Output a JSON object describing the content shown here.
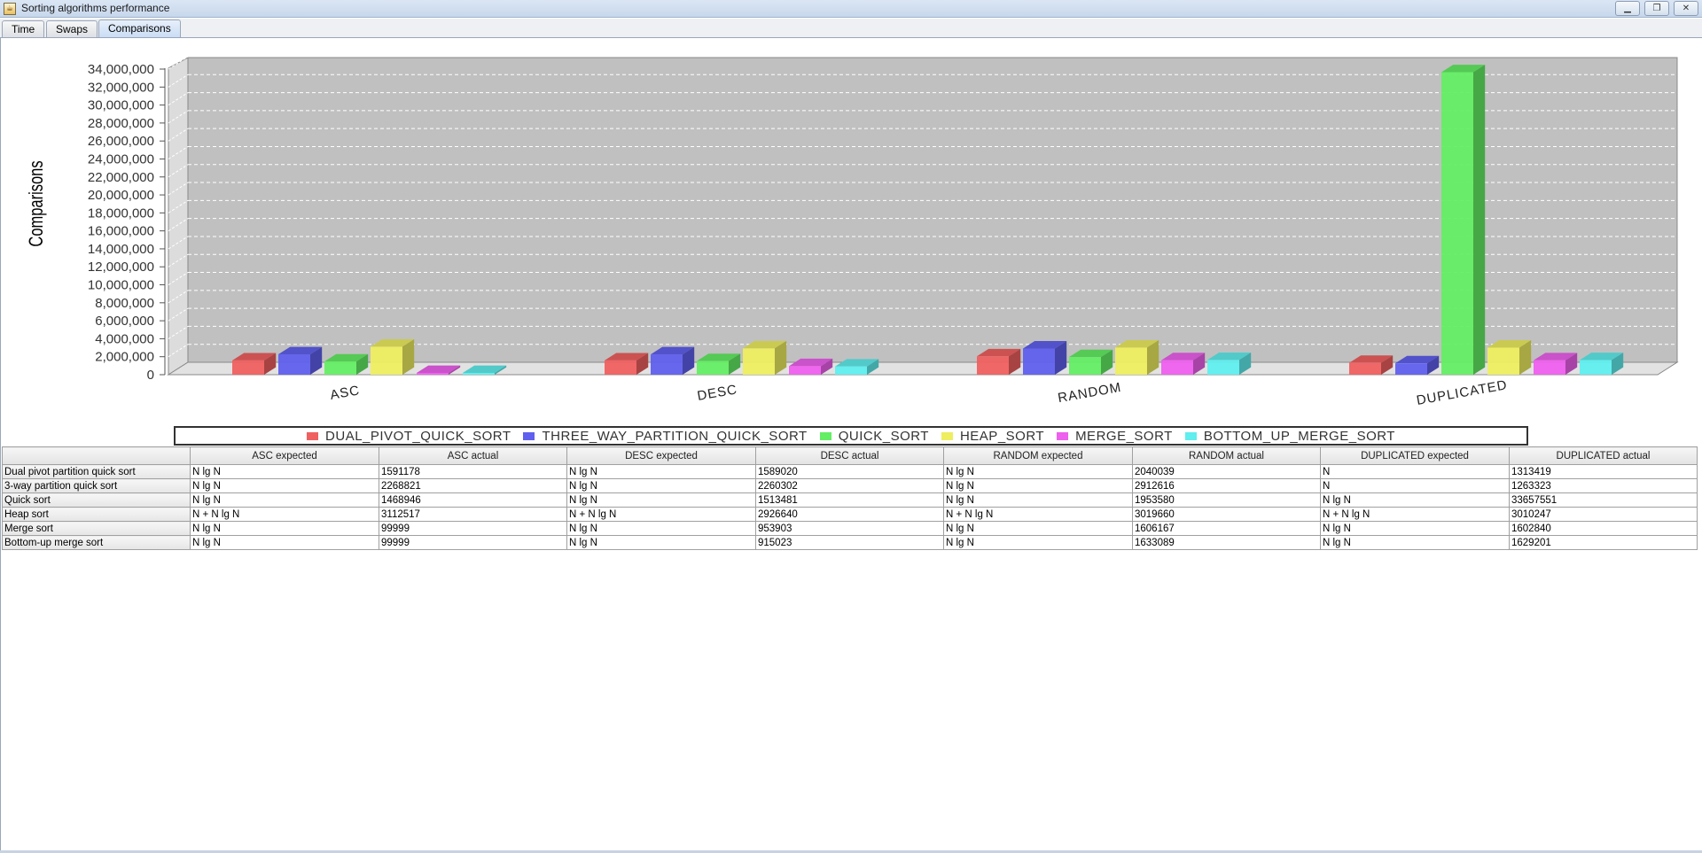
{
  "window": {
    "title": "Sorting algorithms performance",
    "icon": "java-app-icon"
  },
  "tabs": [
    {
      "label": "Time",
      "active": false
    },
    {
      "label": "Swaps",
      "active": false
    },
    {
      "label": "Comparisons",
      "active": true
    }
  ],
  "chart_data": {
    "type": "bar",
    "ylabel": "Comparisons",
    "ylim": [
      0,
      34000000
    ],
    "yticks": [
      "0",
      "2,000,000",
      "4,000,000",
      "6,000,000",
      "8,000,000",
      "10,000,000",
      "12,000,000",
      "14,000,000",
      "16,000,000",
      "18,000,000",
      "20,000,000",
      "22,000,000",
      "24,000,000",
      "26,000,000",
      "28,000,000",
      "30,000,000",
      "32,000,000",
      "34,000,000"
    ],
    "categories": [
      "ASC",
      "DESC",
      "RANDOM",
      "DUPLICATED"
    ],
    "grid": true,
    "legend_position": "bottom",
    "series": [
      {
        "name": "DUAL_PIVOT_QUICK_SORT",
        "color": "#f06060",
        "values": [
          1591178,
          1589020,
          2040039,
          1313419
        ]
      },
      {
        "name": "THREE_WAY_PARTITION_QUICK_SORT",
        "color": "#6060ee",
        "values": [
          2268821,
          2260302,
          2912616,
          1263323
        ]
      },
      {
        "name": "QUICK_SORT",
        "color": "#64ee64",
        "values": [
          1468946,
          1513481,
          1953580,
          33657551
        ]
      },
      {
        "name": "HEAP_SORT",
        "color": "#eeee60",
        "values": [
          3112517,
          2926640,
          3019660,
          3010247
        ]
      },
      {
        "name": "MERGE_SORT",
        "color": "#ee60ee",
        "values": [
          99999,
          953903,
          1606167,
          1602840
        ]
      },
      {
        "name": "BOTTOM_UP_MERGE_SORT",
        "color": "#60eeee",
        "values": [
          99999,
          915023,
          1633089,
          1629201
        ]
      }
    ]
  },
  "table": {
    "columns": [
      "",
      "ASC expected",
      "ASC actual",
      "DESC expected",
      "DESC actual",
      "RANDOM expected",
      "RANDOM actual",
      "DUPLICATED expected",
      "DUPLICATED actual"
    ],
    "rows": [
      [
        "Dual pivot partition quick sort",
        "N lg N",
        "1591178",
        "N lg N",
        "1589020",
        "N lg N",
        "2040039",
        "N",
        "1313419"
      ],
      [
        "3-way partition quick sort",
        "N lg N",
        "2268821",
        "N lg N",
        "2260302",
        "N lg N",
        "2912616",
        "N",
        "1263323"
      ],
      [
        "Quick sort",
        "N lg N",
        "1468946",
        "N lg N",
        "1513481",
        "N lg N",
        "1953580",
        "N lg N",
        "33657551"
      ],
      [
        "Heap sort",
        "N + N lg N",
        "3112517",
        "N + N lg N",
        "2926640",
        "N + N lg N",
        "3019660",
        "N + N lg N",
        "3010247"
      ],
      [
        "Merge sort",
        "N lg N",
        "99999",
        "N lg N",
        "953903",
        "N lg N",
        "1606167",
        "N lg N",
        "1602840"
      ],
      [
        "Bottom-up merge sort",
        "N lg N",
        "99999",
        "N lg N",
        "915023",
        "N lg N",
        "1633089",
        "N lg N",
        "1629201"
      ]
    ]
  }
}
